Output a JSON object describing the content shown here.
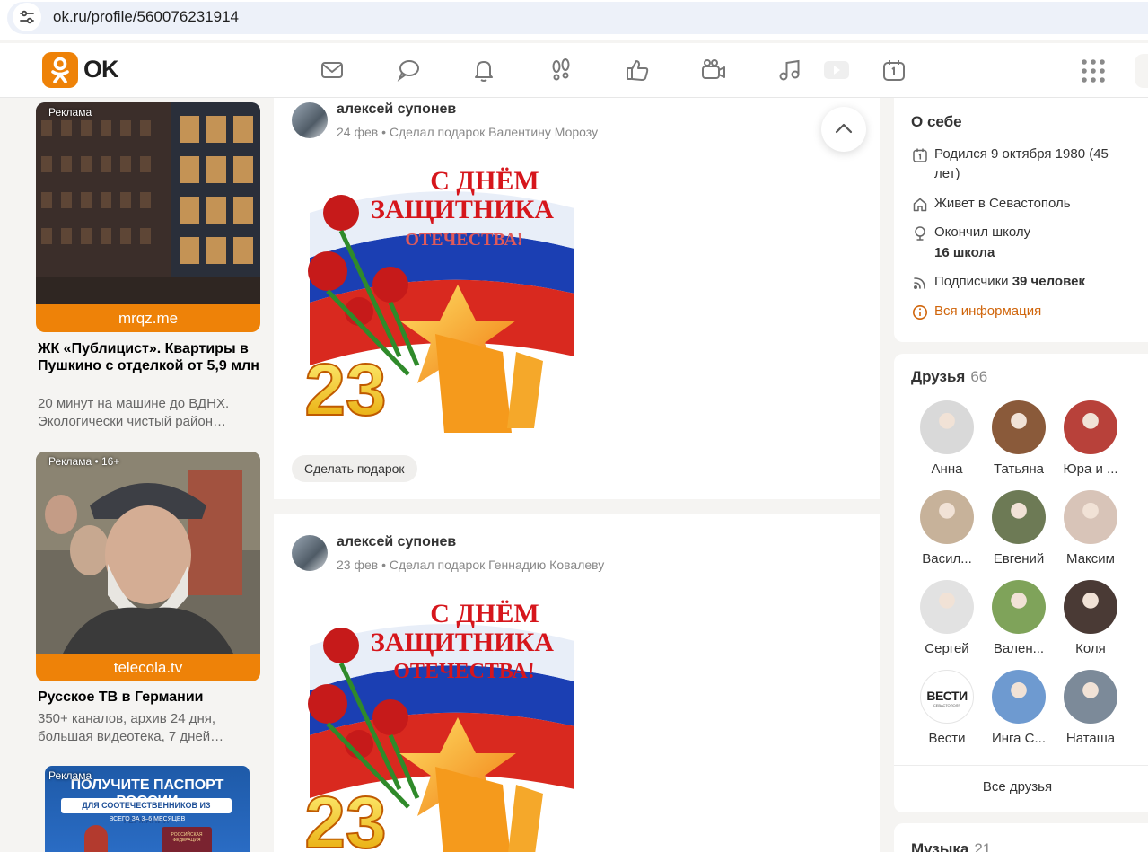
{
  "browser": {
    "url": "ok.ru/profile/560076231914"
  },
  "header": {
    "logo_text": "OK",
    "nav": [
      "mail-icon",
      "chat-icon",
      "bell-icon",
      "footprints-icon",
      "like-icon",
      "camera-icon",
      "music-icon",
      "video-icon",
      "calendar-icon"
    ]
  },
  "ads": [
    {
      "tag": "Реклама",
      "domain": "mrqz.me",
      "title": "ЖК «Публицист». Квартиры в Пушкино с отделкой от 5,9 млн",
      "desc": "20 минут на машине до ВДНХ. Экологически чистый район…"
    },
    {
      "tag": "Реклама • 16+",
      "domain": "telecola.tv",
      "title": "Русское ТВ в Германии",
      "desc": "350+ каналов, архив 24 дня, большая видеотека, 7 дней…"
    },
    {
      "tag": "Реклама",
      "banner_line1": "ПОЛУЧИТЕ ПАСПОРТ РОССИИ",
      "banner_line2": "ДЛЯ СООТЕЧЕСТВЕННИКОВ ИЗ ГЕРМАНИИ",
      "banner_line3": "ВСЕГО ЗА 3–6 МЕСЯЦЕВ",
      "banner_passport": "РОССИЙСКАЯ ФЕДЕРАЦИЯ"
    }
  ],
  "posts": [
    {
      "author": "алексей супонев",
      "date": "24 фев",
      "action": "Сделал подарок Валентину Морозу",
      "gift_button": "Сделать подарок",
      "card": {
        "line1": "С ДНЁМ",
        "line2": "ЗАЩИТНИКА",
        "line3": "ОТЕЧЕСТВА!",
        "number": "23"
      }
    },
    {
      "author": "алексей супонев",
      "date": "23 фев",
      "action": "Сделал подарок Геннадию Ковалеву",
      "card": {
        "line1": "С ДНЁМ",
        "line2": "ЗАЩИТНИКА",
        "line3": "ОТЕЧЕСТВА!",
        "number": "23"
      }
    }
  ],
  "about": {
    "title": "О себе",
    "born": "Родился 9 октября 1980 (45 лет)",
    "lives": "Живет в Севастополь",
    "school_label": "Окончил школу",
    "school": "16 школа",
    "subs_label": "Подписчики",
    "subs": "39 человек",
    "all_info": "Вся информация"
  },
  "friends": {
    "title": "Друзья",
    "count": "66",
    "items": [
      {
        "name": "Анна",
        "color": "#d9d9d9"
      },
      {
        "name": "Татьяна",
        "color": "#8a5a3a"
      },
      {
        "name": "Юра и ...",
        "color": "#b8413a"
      },
      {
        "name": "Васил...",
        "color": "#c7b29a"
      },
      {
        "name": "Евгений",
        "color": "#6d7a55"
      },
      {
        "name": "Максим",
        "color": "#d8c4b8"
      },
      {
        "name": "Сергей",
        "color": "#e2e2e2"
      },
      {
        "name": "Вален...",
        "color": "#7fa35a"
      },
      {
        "name": "Коля",
        "color": "#4a3a35"
      },
      {
        "name": "Вести",
        "logo": "ВЕСТИ",
        "logo_sub": "СЕВАСТОПОЛЯ",
        "color": "#ffffff"
      },
      {
        "name": "Инга С...",
        "color": "#6e9ad0"
      },
      {
        "name": "Наташа",
        "color": "#7c8a99"
      }
    ],
    "all": "Все друзья"
  },
  "music": {
    "title": "Музыка",
    "count": "21"
  }
}
